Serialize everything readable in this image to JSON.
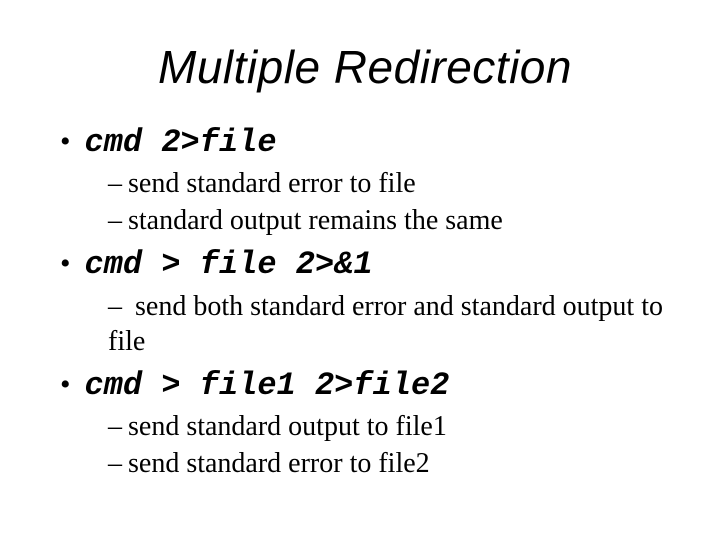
{
  "title": "Multiple Redirection",
  "items": [
    {
      "cmd": "cmd 2>file",
      "subs": [
        "send standard error to file",
        "standard output remains the same"
      ]
    },
    {
      "cmd": "cmd > file 2>&1",
      "subs": [
        " send both standard error and standard output to file"
      ]
    },
    {
      "cmd": "cmd > file1 2>file2",
      "subs": [
        "send standard output to file1",
        "send standard error to file2"
      ]
    }
  ]
}
